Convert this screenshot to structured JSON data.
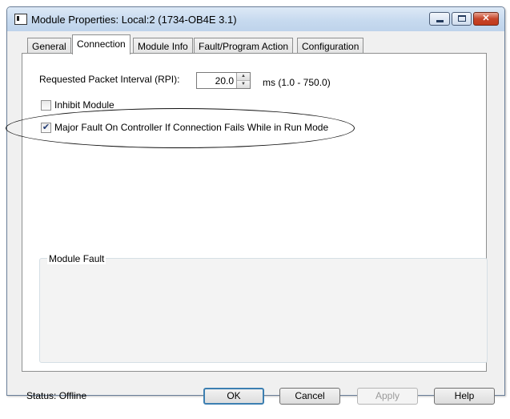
{
  "window": {
    "title": "Module Properties: Local:2 (1734-OB4E 3.1)"
  },
  "tabs": [
    {
      "label": "General"
    },
    {
      "label": "Connection"
    },
    {
      "label": "Module Info"
    },
    {
      "label": "Fault/Program Action"
    },
    {
      "label": "Configuration"
    }
  ],
  "connection": {
    "rpi_label": "Requested Packet Interval (RPI):",
    "rpi_value": "20.0",
    "rpi_range": "ms (1.0 - 750.0)",
    "inhibit_label": "Inhibit Module",
    "inhibit_checked": false,
    "major_fault_label": "Major Fault On Controller If Connection Fails While in Run Mode",
    "major_fault_checked": true,
    "module_fault_title": "Module Fault"
  },
  "footer": {
    "status": "Status:  Offline",
    "ok": "OK",
    "cancel": "Cancel",
    "apply": "Apply",
    "help": "Help"
  }
}
